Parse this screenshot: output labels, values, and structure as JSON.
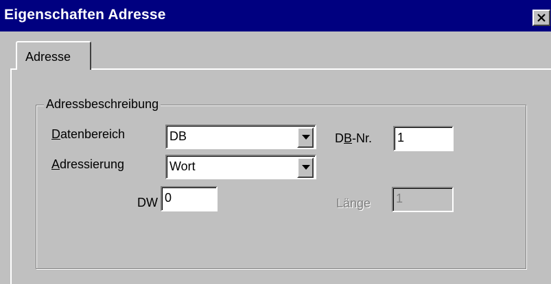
{
  "window": {
    "title": "Eigenschaften Adresse",
    "close_icon": "close-icon"
  },
  "tabs": [
    {
      "label": "Adresse",
      "selected": true
    }
  ],
  "group": {
    "title": "Adressbeschreibung"
  },
  "fields": {
    "datenbereich": {
      "label_prefix": "",
      "label_mnemonic": "D",
      "label_rest": "atenbereich",
      "value": "DB"
    },
    "adressierung": {
      "label_prefix": "",
      "label_mnemonic": "A",
      "label_rest": "dressierung",
      "value": "Wort"
    },
    "db_nr": {
      "label_prefix": "D",
      "label_mnemonic": "B",
      "label_rest": "-Nr.",
      "value": "1"
    },
    "dw": {
      "label": "DW",
      "value": "0"
    },
    "laenge": {
      "label": "Länge",
      "value": "1",
      "disabled": true
    }
  },
  "colors": {
    "title_bar": "#000080",
    "face": "#c0c0c0",
    "field": "#ffffff",
    "disabled_text": "#808080"
  }
}
